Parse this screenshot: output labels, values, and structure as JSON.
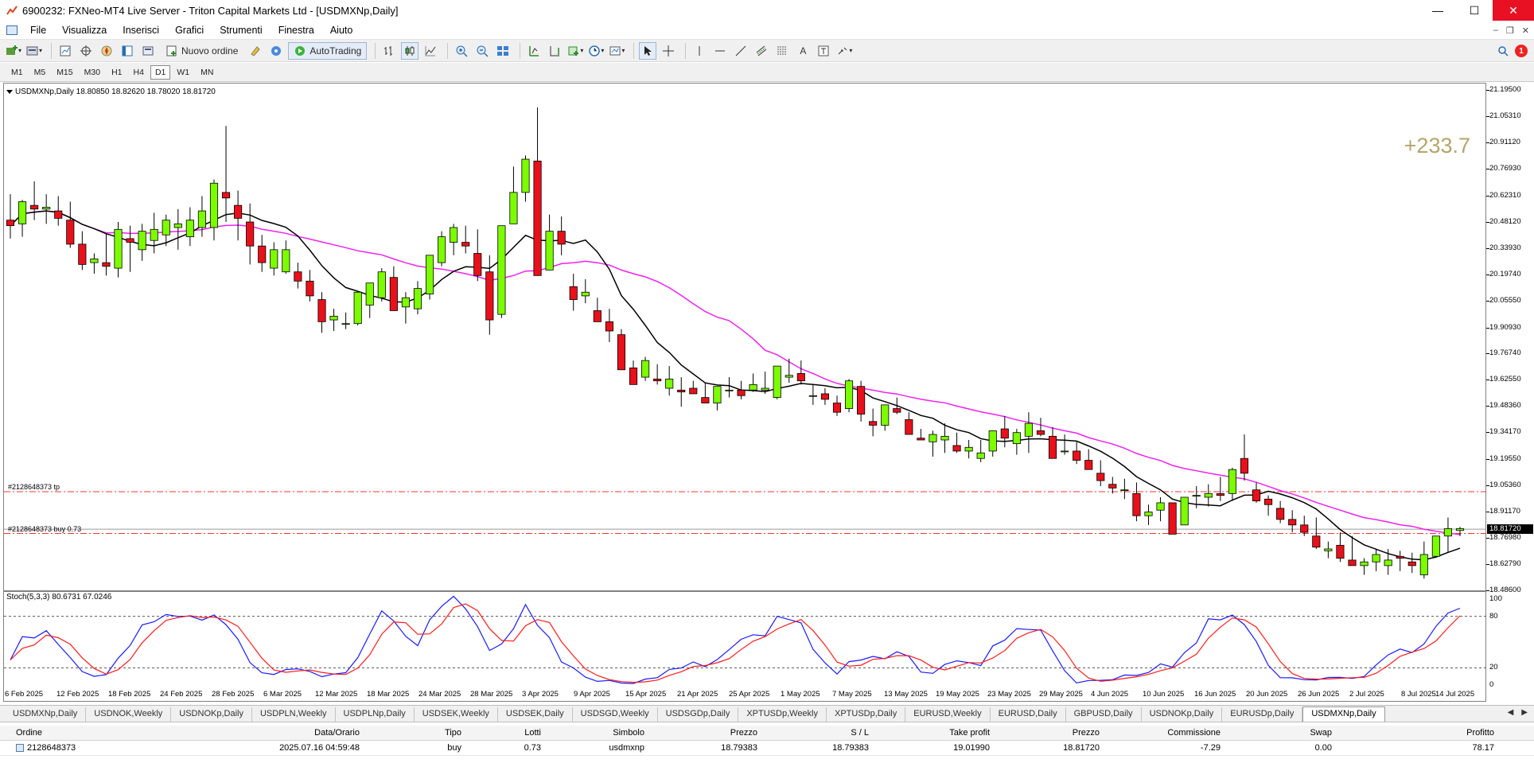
{
  "window": {
    "title": "6900232: FXNeo-MT4 Live Server - Triton Capital Markets Ltd - [USDMXNp,Daily]",
    "controls": [
      "—",
      "☐",
      "✕"
    ]
  },
  "menu": {
    "items": [
      "File",
      "Visualizza",
      "Inserisci",
      "Grafici",
      "Strumenti",
      "Finestra",
      "Aiuto"
    ],
    "notification_count": "1"
  },
  "toolbar": {
    "new_order_label": "Nuovo ordine",
    "autotrading_label": "AutoTrading"
  },
  "timeframes": [
    "M1",
    "M5",
    "M15",
    "M30",
    "H1",
    "H4",
    "D1",
    "W1",
    "MN"
  ],
  "active_timeframe": "D1",
  "chart": {
    "header": "USDMXNp,Daily  18.80850 18.82620 18.78020 18.81720",
    "profit_label": "+233.7",
    "order_tp_label": "#2128648373 tp",
    "order_buy_label": "#2128648373 buy 0.73",
    "current_price": "18.81720",
    "price_axis_labels": [
      "21.19500",
      "21.05310",
      "20.91120",
      "20.76930",
      "20.62310",
      "20.48120",
      "20.33930",
      "20.19740",
      "20.05550",
      "19.90930",
      "19.76740",
      "19.62550",
      "19.48360",
      "19.34170",
      "19.19550",
      "19.05360",
      "18.91170",
      "18.76980",
      "18.62790",
      "18.48600"
    ],
    "stoch_title": "Stoch(5,3,3) 80.6731 67.0246",
    "stoch_axis_labels": [
      "100",
      "80",
      "20",
      "0"
    ],
    "date_labels": [
      "6 Feb 2025",
      "12 Feb 2025",
      "18 Feb 2025",
      "24 Feb 2025",
      "28 Feb 2025",
      "6 Mar 2025",
      "12 Mar 2025",
      "18 Mar 2025",
      "24 Mar 2025",
      "28 Mar 2025",
      "3 Apr 2025",
      "9 Apr 2025",
      "15 Apr 2025",
      "21 Apr 2025",
      "25 Apr 2025",
      "1 May 2025",
      "7 May 2025",
      "13 May 2025",
      "19 May 2025",
      "23 May 2025",
      "29 May 2025",
      "4 Jun 2025",
      "10 Jun 2025",
      "16 Jun 2025",
      "20 Jun 2025",
      "26 Jun 2025",
      "2 Jul 2025",
      "8 Jul 2025",
      "14 Jul 2025"
    ],
    "colors": {
      "bull": "#7cfc00",
      "bear": "#e8101a",
      "ma_fast": "#000000",
      "ma_slow": "#ee22ee",
      "stoch_main": "#1a1aff",
      "stoch_signal": "#ff1a1a",
      "order_line": "#ff3030"
    }
  },
  "chart_data": {
    "type": "candlestick",
    "symbol": "USDMXNp",
    "timeframe": "Daily",
    "ylim": [
      18.486,
      21.195
    ],
    "price_levels": {
      "take_profit": 19.0199,
      "open": 18.79383,
      "current": 18.8172
    },
    "candles": [
      [
        20.49,
        20.63,
        20.39,
        20.46
      ],
      [
        20.47,
        20.6,
        20.4,
        20.59
      ],
      [
        20.57,
        20.7,
        20.49,
        20.55
      ],
      [
        20.55,
        20.63,
        20.47,
        20.56
      ],
      [
        20.54,
        20.62,
        20.46,
        20.5
      ],
      [
        20.49,
        20.59,
        20.34,
        20.36
      ],
      [
        20.36,
        20.43,
        20.22,
        20.25
      ],
      [
        20.26,
        20.31,
        20.2,
        20.28
      ],
      [
        20.26,
        20.42,
        20.19,
        20.24
      ],
      [
        20.23,
        20.48,
        20.18,
        20.44
      ],
      [
        20.39,
        20.46,
        20.21,
        20.37
      ],
      [
        20.33,
        20.47,
        20.27,
        20.43
      ],
      [
        20.38,
        20.53,
        20.31,
        20.44
      ],
      [
        20.41,
        20.52,
        20.35,
        20.49
      ],
      [
        20.45,
        20.55,
        20.33,
        20.47
      ],
      [
        20.4,
        20.56,
        20.35,
        20.49
      ],
      [
        20.45,
        20.62,
        20.4,
        20.54
      ],
      [
        20.45,
        20.71,
        20.38,
        20.69
      ],
      [
        20.64,
        21.0,
        20.48,
        20.61
      ],
      [
        20.57,
        20.65,
        20.38,
        20.5
      ],
      [
        20.48,
        20.58,
        20.25,
        20.35
      ],
      [
        20.35,
        20.41,
        20.21,
        20.26
      ],
      [
        20.23,
        20.37,
        20.19,
        20.33
      ],
      [
        20.21,
        20.38,
        20.2,
        20.33
      ],
      [
        20.21,
        20.26,
        20.12,
        20.16
      ],
      [
        20.16,
        20.22,
        20.05,
        20.08
      ],
      [
        20.06,
        20.1,
        19.88,
        19.94
      ],
      [
        19.95,
        20.01,
        19.89,
        19.97
      ],
      [
        19.93,
        19.99,
        19.9,
        19.93
      ],
      [
        19.93,
        20.08,
        19.92,
        20.1
      ],
      [
        20.03,
        20.15,
        19.96,
        20.15
      ],
      [
        20.07,
        20.23,
        20.05,
        20.21
      ],
      [
        20.18,
        20.24,
        20.0,
        20.0
      ],
      [
        20.02,
        20.1,
        19.93,
        20.07
      ],
      [
        20.01,
        20.16,
        19.98,
        20.12
      ],
      [
        20.09,
        20.22,
        20.06,
        20.3
      ],
      [
        20.26,
        20.43,
        20.24,
        20.4
      ],
      [
        20.37,
        20.47,
        20.3,
        20.45
      ],
      [
        20.37,
        20.46,
        20.31,
        20.35
      ],
      [
        20.31,
        20.44,
        20.16,
        20.19
      ],
      [
        20.21,
        20.3,
        19.87,
        19.95
      ],
      [
        19.98,
        20.46,
        19.96,
        20.46
      ],
      [
        20.47,
        20.78,
        20.5,
        20.64
      ],
      [
        20.64,
        20.84,
        20.59,
        20.82
      ],
      [
        20.81,
        21.1,
        20.6,
        20.19
      ],
      [
        20.22,
        20.52,
        20.25,
        20.43
      ],
      [
        20.43,
        20.51,
        20.3,
        20.36
      ],
      [
        20.13,
        20.2,
        20.0,
        20.06
      ],
      [
        20.08,
        20.17,
        20.04,
        20.1
      ],
      [
        20.0,
        20.07,
        19.95,
        19.94
      ],
      [
        19.94,
        20.01,
        19.83,
        19.89
      ],
      [
        19.87,
        19.9,
        19.68,
        19.68
      ],
      [
        19.69,
        19.73,
        19.62,
        19.6
      ],
      [
        19.64,
        19.75,
        19.62,
        19.73
      ],
      [
        19.63,
        19.71,
        19.6,
        19.62
      ],
      [
        19.58,
        19.7,
        19.54,
        19.63
      ],
      [
        19.57,
        19.64,
        19.48,
        19.56
      ],
      [
        19.58,
        19.62,
        19.55,
        19.55
      ],
      [
        19.53,
        19.61,
        19.5,
        19.5
      ],
      [
        19.5,
        19.59,
        19.46,
        19.59
      ],
      [
        19.57,
        19.64,
        19.53,
        19.57
      ],
      [
        19.57,
        19.62,
        19.52,
        19.54
      ],
      [
        19.57,
        19.66,
        19.56,
        19.6
      ],
      [
        19.57,
        19.67,
        19.55,
        19.58
      ],
      [
        19.53,
        19.68,
        19.52,
        19.7
      ],
      [
        19.64,
        19.74,
        19.61,
        19.65
      ],
      [
        19.66,
        19.73,
        19.6,
        19.62
      ],
      [
        19.54,
        19.6,
        19.49,
        19.54
      ],
      [
        19.55,
        19.58,
        19.49,
        19.52
      ],
      [
        19.5,
        19.54,
        19.43,
        19.45
      ],
      [
        19.47,
        19.63,
        19.45,
        19.62
      ],
      [
        19.59,
        19.62,
        19.4,
        19.44
      ],
      [
        19.4,
        19.47,
        19.32,
        19.38
      ],
      [
        19.38,
        19.47,
        19.35,
        19.49
      ],
      [
        19.47,
        19.53,
        19.44,
        19.45
      ],
      [
        19.41,
        19.45,
        19.33,
        19.33
      ],
      [
        19.31,
        19.36,
        19.3,
        19.3
      ],
      [
        19.29,
        19.35,
        19.21,
        19.33
      ],
      [
        19.3,
        19.39,
        19.23,
        19.32
      ],
      [
        19.27,
        19.34,
        19.23,
        19.24
      ],
      [
        19.24,
        19.3,
        19.2,
        19.26
      ],
      [
        19.2,
        19.3,
        19.18,
        19.23
      ],
      [
        19.24,
        19.35,
        19.21,
        19.35
      ],
      [
        19.36,
        19.43,
        19.26,
        19.31
      ],
      [
        19.28,
        19.36,
        19.22,
        19.34
      ],
      [
        19.32,
        19.45,
        19.23,
        19.39
      ],
      [
        19.35,
        19.42,
        19.32,
        19.33
      ],
      [
        19.32,
        19.37,
        19.24,
        19.2
      ],
      [
        19.24,
        19.33,
        19.22,
        19.24
      ],
      [
        19.24,
        19.29,
        19.17,
        19.19
      ],
      [
        19.19,
        19.25,
        19.14,
        19.14
      ],
      [
        19.12,
        19.19,
        19.05,
        19.08
      ],
      [
        19.06,
        19.1,
        19.01,
        19.04
      ],
      [
        19.03,
        19.09,
        18.98,
        19.03
      ],
      [
        19.01,
        19.07,
        18.86,
        18.89
      ],
      [
        18.89,
        18.95,
        18.84,
        18.91
      ],
      [
        18.92,
        18.99,
        18.86,
        18.96
      ],
      [
        18.96,
        18.96,
        18.8,
        18.79
      ],
      [
        18.84,
        18.99,
        18.84,
        18.99
      ],
      [
        19.0,
        19.05,
        18.93,
        19.0
      ],
      [
        18.99,
        19.06,
        18.94,
        19.01
      ],
      [
        19.01,
        19.1,
        18.97,
        19.0
      ],
      [
        19.01,
        19.15,
        18.97,
        19.14
      ],
      [
        19.2,
        19.33,
        19.08,
        19.12
      ],
      [
        19.03,
        19.07,
        18.96,
        18.97
      ],
      [
        18.98,
        19.0,
        18.89,
        18.95
      ],
      [
        18.93,
        18.97,
        18.85,
        18.87
      ],
      [
        18.87,
        18.92,
        18.8,
        18.84
      ],
      [
        18.84,
        18.89,
        18.78,
        18.8
      ],
      [
        18.78,
        18.88,
        18.71,
        18.72
      ],
      [
        18.7,
        18.75,
        18.66,
        18.71
      ],
      [
        18.73,
        18.8,
        18.64,
        18.66
      ],
      [
        18.65,
        18.78,
        18.62,
        18.62
      ],
      [
        18.62,
        18.66,
        18.57,
        18.64
      ],
      [
        18.64,
        18.71,
        18.59,
        18.68
      ],
      [
        18.62,
        18.71,
        18.57,
        18.65
      ],
      [
        18.67,
        18.7,
        18.59,
        18.66
      ],
      [
        18.64,
        18.69,
        18.58,
        18.62
      ],
      [
        18.57,
        18.75,
        18.55,
        18.68
      ],
      [
        18.67,
        18.77,
        18.68,
        18.78
      ],
      [
        18.78,
        18.88,
        18.69,
        18.82
      ],
      [
        18.81,
        18.83,
        18.78,
        18.82
      ]
    ],
    "stochastic": {
      "params": "5,3,3",
      "main_last": 80.6731,
      "signal_last": 67.0246,
      "levels": [
        80,
        20
      ]
    }
  },
  "tabs": [
    "USDMXNp,Daily",
    "USDNOK,Weekly",
    "USDNOKp,Daily",
    "USDPLN,Weekly",
    "USDPLNp,Daily",
    "USDSEK,Weekly",
    "USDSEK,Daily",
    "USDSGD,Weekly",
    "USDSGDp,Daily",
    "XPTUSDp,Weekly",
    "XPTUSDp,Daily",
    "EURUSD,Weekly",
    "EURUSD,Daily",
    "GBPUSD,Daily",
    "USDNOKp,Daily",
    "EURUSDp,Daily",
    "USDMXNp,Daily"
  ],
  "active_tab_index": 16,
  "orders": {
    "headers": [
      "Ordine",
      "Data/Orario",
      "Tipo",
      "Lotti",
      "Simbolo",
      "Prezzo",
      "S / L",
      "Take profit",
      "Prezzo",
      "Commissione",
      "Swap",
      "Profitto"
    ],
    "rows": [
      [
        "2128648373",
        "2025.07.16 04:59:48",
        "buy",
        "0.73",
        "usdmxnp",
        "18.79383",
        "18.79383",
        "19.01990",
        "18.81720",
        "-7.29",
        "0.00",
        "78.17"
      ]
    ]
  }
}
